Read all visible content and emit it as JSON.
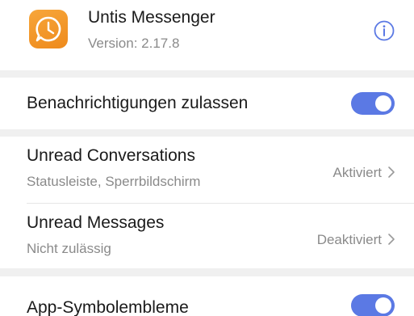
{
  "app": {
    "name": "Untis Messenger",
    "version": "Version: 2.17.8",
    "icon": "untis-messenger-clock-icon",
    "info_icon": "info-icon"
  },
  "colors": {
    "accent": "#5b79e4",
    "app_icon": "#f29a28",
    "section_gap": "#f0f0f0",
    "secondary_text": "#8a8a8a"
  },
  "allow_notifications": {
    "label": "Benachrichtigungen zulassen",
    "enabled": true
  },
  "channels": [
    {
      "title": "Unread Conversations",
      "subtitle": "Statusleiste, Sperrbildschirm",
      "status": "Aktiviert"
    },
    {
      "title": "Unread Messages",
      "subtitle": "Nicht zulässig",
      "status": "Deaktiviert"
    }
  ],
  "app_badges": {
    "label": "App-Symbolembleme",
    "enabled": true
  }
}
